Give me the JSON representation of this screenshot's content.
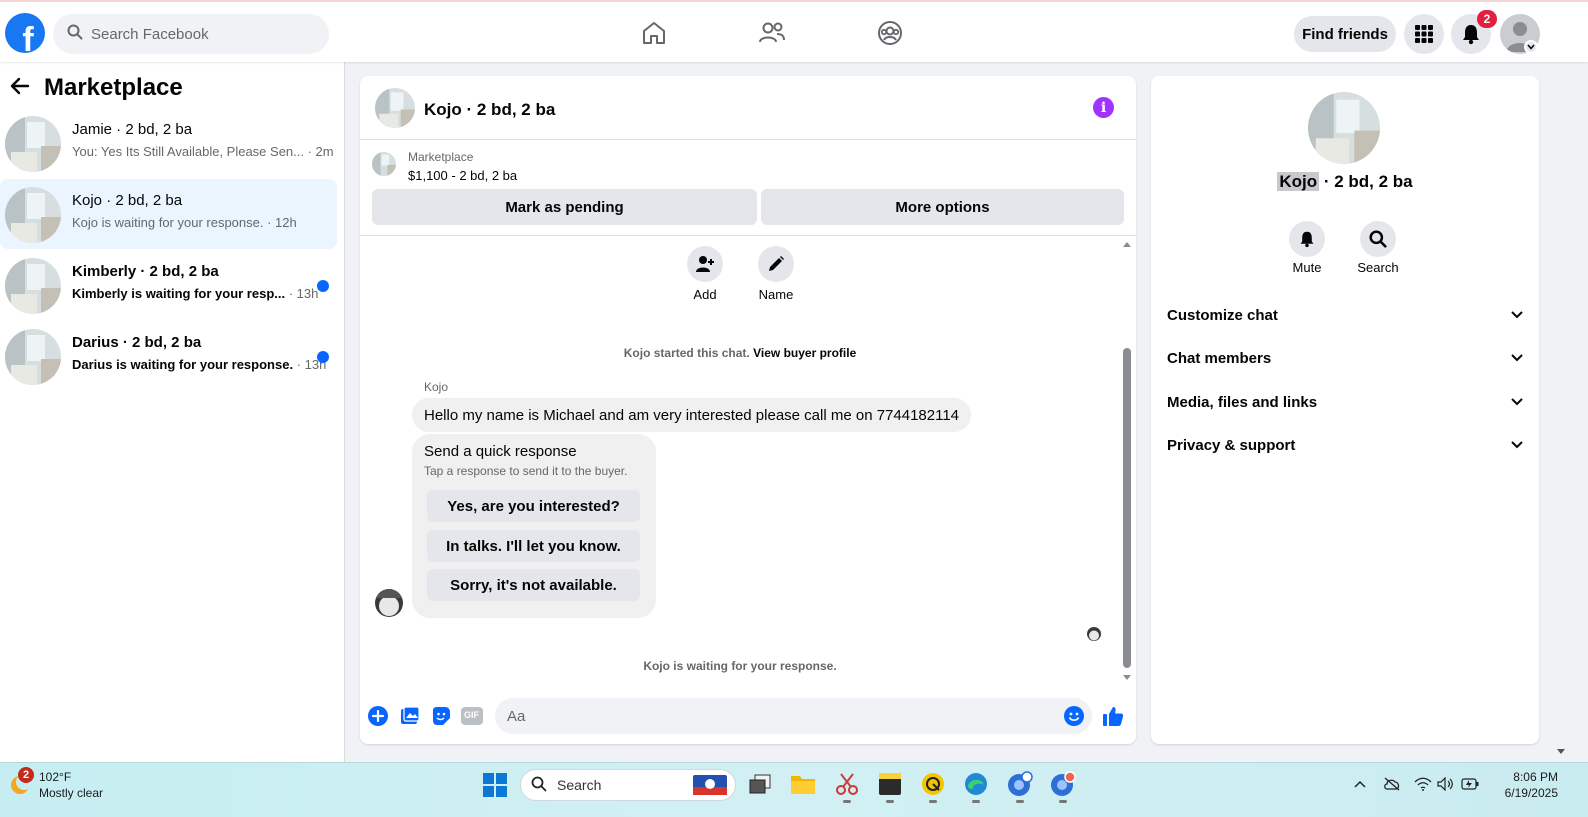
{
  "topbar": {
    "logo_letter": "f",
    "search_placeholder": "Search Facebook",
    "find_friends_label": "Find friends",
    "notifications_count": "2"
  },
  "sidebar": {
    "title": "Marketplace",
    "conversations": [
      {
        "name": "Jamie · 2 bd, 2 ba",
        "snippet": "You: Yes Its Still Available, Please Sen...",
        "time": " · 2m",
        "unread": false,
        "active": false
      },
      {
        "name": "Kojo · 2 bd, 2 ba",
        "snippet": "Kojo is waiting for your response.",
        "time": " · 12h",
        "unread": false,
        "active": true
      },
      {
        "name": "Kimberly · 2 bd, 2 ba",
        "snippet": "Kimberly is waiting for your resp...",
        "time": " · 13h",
        "unread": true,
        "active": false
      },
      {
        "name": "Darius · 2 bd, 2 ba",
        "snippet": "Darius is waiting for your response.",
        "time": " · 13h",
        "unread": true,
        "active": false
      }
    ]
  },
  "chat": {
    "title": "Kojo · 2 bd, 2 ba",
    "listing": {
      "source": "Marketplace",
      "price": "$1,100 - 2 bd, 2 ba",
      "mark_pending_label": "Mark as pending",
      "more_options_label": "More options"
    },
    "actions": {
      "add_label": "Add",
      "name_label": "Name"
    },
    "started_text": "Kojo started this chat.",
    "view_buyer_link": "View buyer profile",
    "sender": "Kojo",
    "message": "Hello my name is Michael and am very interested please call me on 7744182114",
    "quick_response": {
      "title": "Send a quick response",
      "subtitle": "Tap a response to send it to the buyer.",
      "options": [
        "Yes, are you interested?",
        "In talks. I'll let you know.",
        "Sorry, it's not available."
      ]
    },
    "waiting_text": "Kojo is waiting for your response.",
    "composer_placeholder": "Aa",
    "gif_label": "GIF"
  },
  "right_panel": {
    "title_name": "Kojo",
    "title_rest": " · 2 bd, 2 ba",
    "mute_label": "Mute",
    "search_label": "Search",
    "sections": [
      "Customize chat",
      "Chat members",
      "Media, files and links",
      "Privacy & support"
    ]
  },
  "taskbar": {
    "weather_badge": "2",
    "temperature": "102°F",
    "weather_desc": "Mostly clear",
    "search_label": "Search",
    "time": "8:06 PM",
    "date": "6/19/2025"
  },
  "colors": {
    "brand_blue": "#1877f2",
    "active_row": "#ebf5ff",
    "unread_dot": "#0866ff",
    "info_purple": "#a033ff",
    "badge_red": "#e41e3f"
  }
}
